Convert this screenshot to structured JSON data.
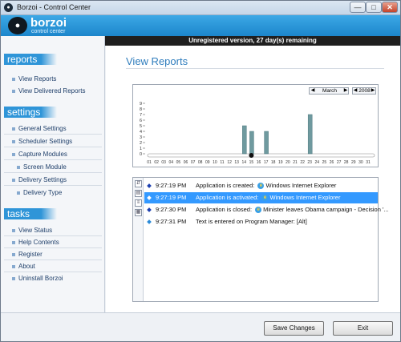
{
  "window": {
    "title": "Borzoi - Control Center"
  },
  "header": {
    "brand": "borzoi",
    "subtitle": "control center",
    "notice": "Unregistered version, 27 day(s) remaining"
  },
  "sidebar": {
    "sections": [
      {
        "title": "reports",
        "items": [
          "View Reports",
          "View Delivered Reports"
        ]
      },
      {
        "title": "settings",
        "items": [
          "General Settings",
          "Scheduler Settings",
          "Capture Modules",
          "Screen Module",
          "Delivery Settings",
          "Delivery Type"
        ]
      },
      {
        "title": "tasks",
        "items": [
          "View Status",
          "Help Contents",
          "Register",
          "About",
          "Uninstall Borzoi"
        ]
      }
    ]
  },
  "main": {
    "title": "View Reports",
    "month": "March",
    "year": "2008",
    "log": [
      {
        "time": "9:27:19 PM",
        "message": "Application is created:",
        "target": "Windows Internet Explorer"
      },
      {
        "time": "9:27:19 PM",
        "message": "Application is activated:",
        "target": "Windows Internet Explorer"
      },
      {
        "time": "9:27:30 PM",
        "message": "Application is closed:",
        "target": "Minister leaves Obama campaign - Decision '..."
      },
      {
        "time": "9:27:31 PM",
        "message": "Text is entered on Program Manager: [Alt]",
        "target": ""
      }
    ]
  },
  "footer": {
    "save": "Save Changes",
    "exit": "Exit"
  },
  "colors": {
    "accent": "#2f95d8",
    "header": "#1c86cc",
    "bar": "#6f9a9f",
    "selection": "#3399ff"
  },
  "chart_data": {
    "type": "bar",
    "categories": [
      "01",
      "02",
      "03",
      "04",
      "05",
      "06",
      "07",
      "08",
      "09",
      "10",
      "11",
      "12",
      "13",
      "14",
      "15",
      "16",
      "17",
      "18",
      "19",
      "20",
      "21",
      "22",
      "23",
      "24",
      "25",
      "26",
      "27",
      "28",
      "29",
      "30",
      "31"
    ],
    "values": [
      0,
      0,
      0,
      0,
      0,
      0,
      0,
      0,
      0,
      0,
      0,
      0,
      0,
      5,
      4,
      0,
      4,
      0,
      0,
      0,
      0,
      0,
      7,
      0,
      0,
      0,
      0,
      0,
      0,
      0,
      0
    ],
    "yticks": [
      "0",
      "1",
      "2",
      "3",
      "4",
      "5",
      "6",
      "7",
      "8",
      "9"
    ],
    "ylim": [
      0,
      9
    ],
    "marker_day": "15"
  }
}
